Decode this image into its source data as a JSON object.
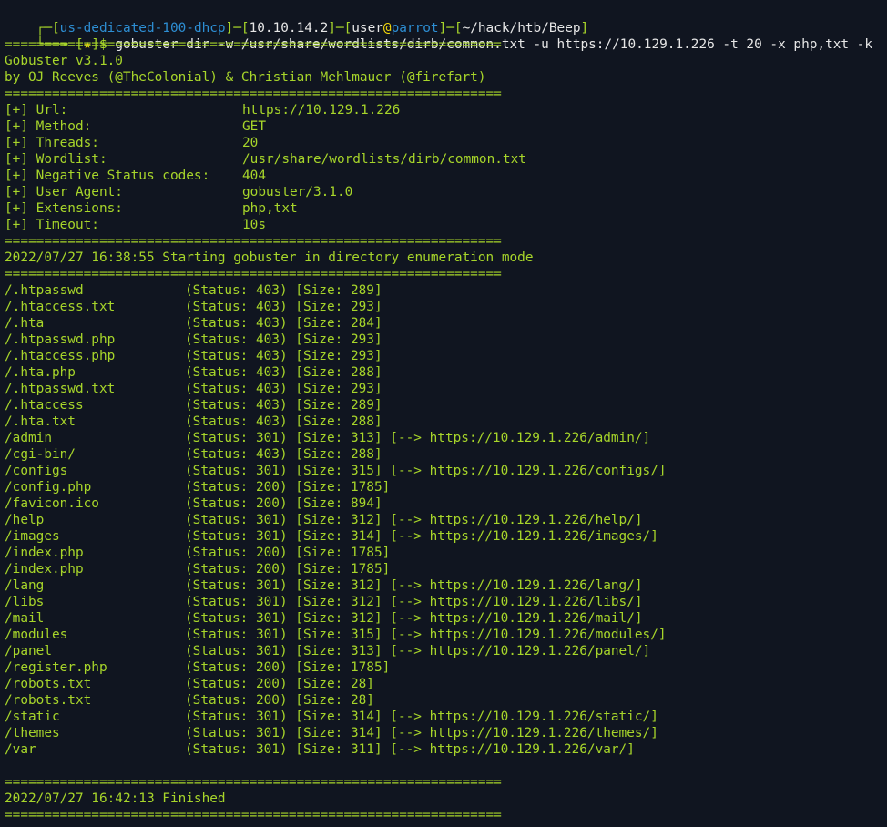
{
  "prompt": {
    "top_rule": "┌─[",
    "host": "us-dedicated-100-dhcp",
    "mid1": "]─[",
    "ip": "10.10.14.2",
    "mid2": "]─[",
    "user": "user",
    "at": "@",
    "machine": "parrot",
    "mid3": "]─[",
    "path": "~/hack/htb/Beep",
    "end": "]",
    "second_prefix": "└──╼ [",
    "star": "★",
    "dollar": "]$ ",
    "command": "gobuster dir -w /usr/share/wordlists/dirb/common.txt -u https://10.129.1.226 -t 20 -x php,txt -k"
  },
  "separator": "===============================================================",
  "banner": {
    "version": "Gobuster v3.1.0",
    "authors": "by OJ Reeves (@TheColonial) & Christian Mehlmauer (@firefart)"
  },
  "config": [
    {
      "key": "[+] Url:",
      "value": "https://10.129.1.226"
    },
    {
      "key": "[+] Method:",
      "value": "GET"
    },
    {
      "key": "[+] Threads:",
      "value": "20"
    },
    {
      "key": "[+] Wordlist:",
      "value": "/usr/share/wordlists/dirb/common.txt"
    },
    {
      "key": "[+] Negative Status codes:",
      "value": "404"
    },
    {
      "key": "[+] User Agent:",
      "value": "gobuster/3.1.0"
    },
    {
      "key": "[+] Extensions:",
      "value": "php,txt"
    },
    {
      "key": "[+] Timeout:",
      "value": "10s"
    }
  ],
  "start_msg": "2022/07/27 16:38:55 Starting gobuster in directory enumeration mode",
  "results": [
    {
      "path": "/.htpasswd",
      "status": "403",
      "size": "289",
      "redirect": ""
    },
    {
      "path": "/.htaccess.txt",
      "status": "403",
      "size": "293",
      "redirect": ""
    },
    {
      "path": "/.hta",
      "status": "403",
      "size": "284",
      "redirect": ""
    },
    {
      "path": "/.htpasswd.php",
      "status": "403",
      "size": "293",
      "redirect": ""
    },
    {
      "path": "/.htaccess.php",
      "status": "403",
      "size": "293",
      "redirect": ""
    },
    {
      "path": "/.hta.php",
      "status": "403",
      "size": "288",
      "redirect": ""
    },
    {
      "path": "/.htpasswd.txt",
      "status": "403",
      "size": "293",
      "redirect": ""
    },
    {
      "path": "/.htaccess",
      "status": "403",
      "size": "289",
      "redirect": ""
    },
    {
      "path": "/.hta.txt",
      "status": "403",
      "size": "288",
      "redirect": ""
    },
    {
      "path": "/admin",
      "status": "301",
      "size": "313",
      "redirect": "https://10.129.1.226/admin/"
    },
    {
      "path": "/cgi-bin/",
      "status": "403",
      "size": "288",
      "redirect": ""
    },
    {
      "path": "/configs",
      "status": "301",
      "size": "315",
      "redirect": "https://10.129.1.226/configs/"
    },
    {
      "path": "/config.php",
      "status": "200",
      "size": "1785",
      "redirect": ""
    },
    {
      "path": "/favicon.ico",
      "status": "200",
      "size": "894",
      "redirect": ""
    },
    {
      "path": "/help",
      "status": "301",
      "size": "312",
      "redirect": "https://10.129.1.226/help/"
    },
    {
      "path": "/images",
      "status": "301",
      "size": "314",
      "redirect": "https://10.129.1.226/images/"
    },
    {
      "path": "/index.php",
      "status": "200",
      "size": "1785",
      "redirect": ""
    },
    {
      "path": "/index.php",
      "status": "200",
      "size": "1785",
      "redirect": ""
    },
    {
      "path": "/lang",
      "status": "301",
      "size": "312",
      "redirect": "https://10.129.1.226/lang/"
    },
    {
      "path": "/libs",
      "status": "301",
      "size": "312",
      "redirect": "https://10.129.1.226/libs/"
    },
    {
      "path": "/mail",
      "status": "301",
      "size": "312",
      "redirect": "https://10.129.1.226/mail/"
    },
    {
      "path": "/modules",
      "status": "301",
      "size": "315",
      "redirect": "https://10.129.1.226/modules/"
    },
    {
      "path": "/panel",
      "status": "301",
      "size": "313",
      "redirect": "https://10.129.1.226/panel/"
    },
    {
      "path": "/register.php",
      "status": "200",
      "size": "1785",
      "redirect": ""
    },
    {
      "path": "/robots.txt",
      "status": "200",
      "size": "28",
      "redirect": ""
    },
    {
      "path": "/robots.txt",
      "status": "200",
      "size": "28",
      "redirect": ""
    },
    {
      "path": "/static",
      "status": "301",
      "size": "314",
      "redirect": "https://10.129.1.226/static/"
    },
    {
      "path": "/themes",
      "status": "301",
      "size": "314",
      "redirect": "https://10.129.1.226/themes/"
    },
    {
      "path": "/var",
      "status": "301",
      "size": "311",
      "redirect": "https://10.129.1.226/var/"
    }
  ],
  "finished_msg": "2022/07/27 16:42:13 Finished"
}
